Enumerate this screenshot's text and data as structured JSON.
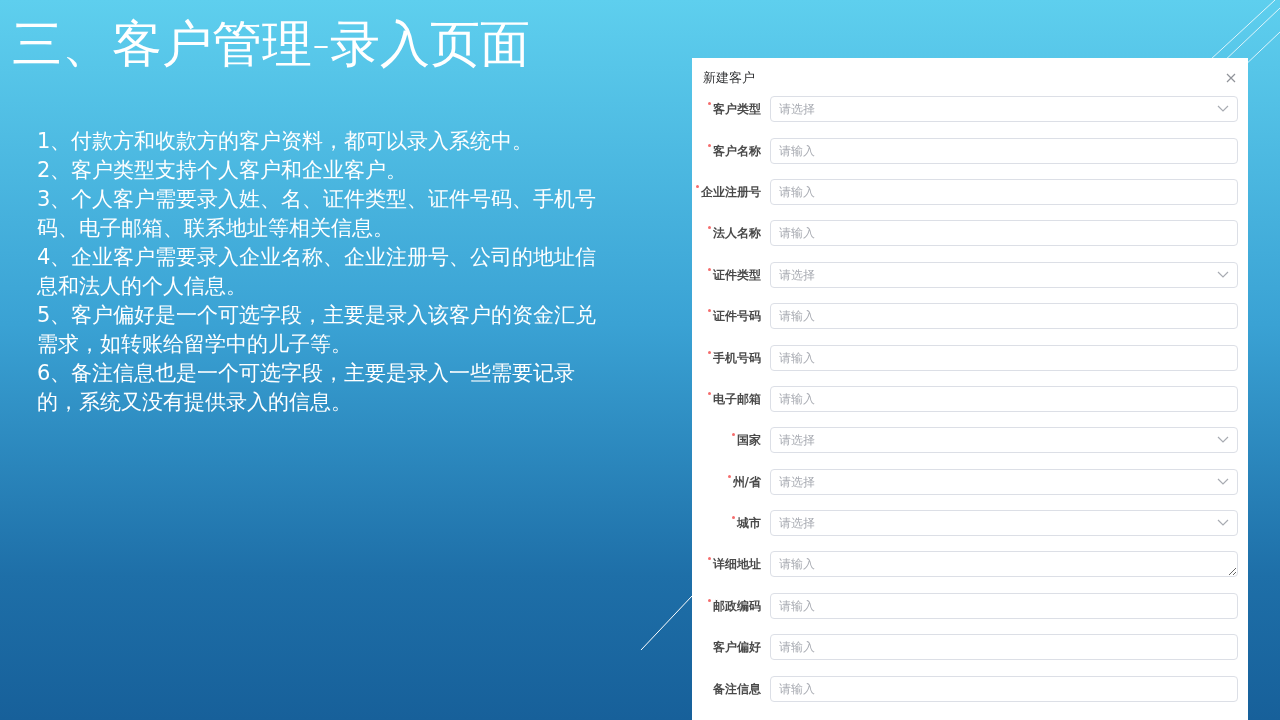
{
  "slide": {
    "title": "三、客户管理-录入页面",
    "points": [
      "1、付款方和收款方的客户资料，都可以录入系统中。",
      "2、客户类型支持个人客户和企业客户。",
      "3、个人客户需要录入姓、名、证件类型、证件号码、手机号码、电子邮箱、联系地址等相关信息。",
      "4、企业客户需要录入企业名称、企业注册号、公司的地址信息和法人的个人信息。",
      "5、客户偏好是一个可选字段，主要是录入该客户的资金汇兑需求，如转账给留学中的儿子等。",
      "6、备注信息也是一个可选字段，主要是录入一些需要记录的，系统又没有提供录入的信息。"
    ]
  },
  "dialog": {
    "title": "新建客户",
    "fields": [
      {
        "label": "客户类型",
        "kind": "select",
        "required": true,
        "placeholder": "请选择"
      },
      {
        "label": "客户名称",
        "kind": "input",
        "required": true,
        "placeholder": "请输入"
      },
      {
        "label": "企业注册号",
        "kind": "input",
        "required": true,
        "placeholder": "请输入"
      },
      {
        "label": "法人名称",
        "kind": "input",
        "required": true,
        "placeholder": "请输入"
      },
      {
        "label": "证件类型",
        "kind": "select",
        "required": true,
        "placeholder": "请选择"
      },
      {
        "label": "证件号码",
        "kind": "input",
        "required": true,
        "placeholder": "请输入"
      },
      {
        "label": "手机号码",
        "kind": "input",
        "required": true,
        "placeholder": "请输入"
      },
      {
        "label": "电子邮箱",
        "kind": "input",
        "required": true,
        "placeholder": "请输入"
      },
      {
        "label": "国家",
        "kind": "select",
        "required": true,
        "placeholder": "请选择"
      },
      {
        "label": "州/省",
        "kind": "select",
        "required": true,
        "placeholder": "请选择"
      },
      {
        "label": "城市",
        "kind": "select",
        "required": true,
        "placeholder": "请选择"
      },
      {
        "label": "详细地址",
        "kind": "textarea",
        "required": true,
        "placeholder": "请输入"
      },
      {
        "label": "邮政编码",
        "kind": "input",
        "required": true,
        "placeholder": "请输入"
      },
      {
        "label": "客户偏好",
        "kind": "input",
        "required": false,
        "placeholder": "请输入"
      },
      {
        "label": "备注信息",
        "kind": "input",
        "required": false,
        "placeholder": "请输入"
      }
    ]
  }
}
